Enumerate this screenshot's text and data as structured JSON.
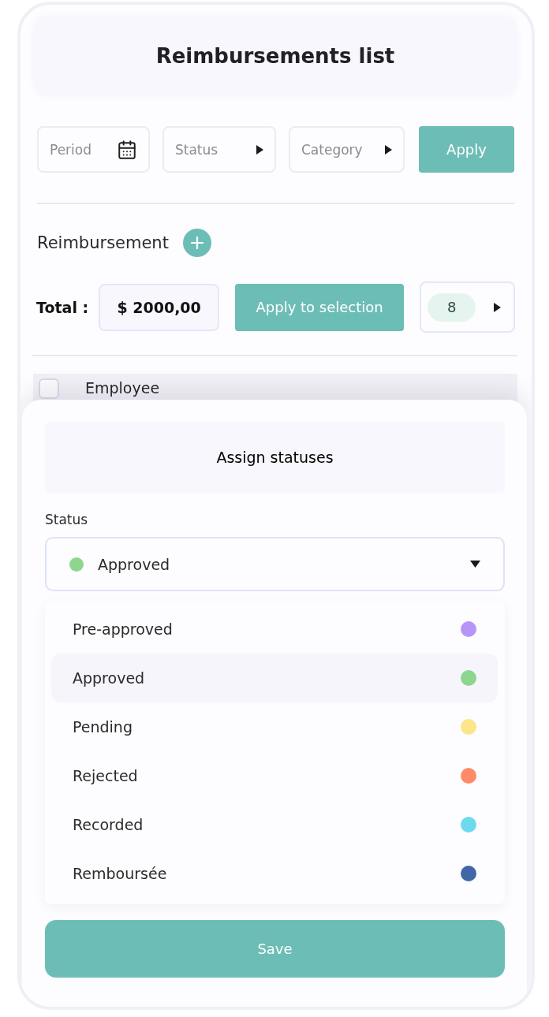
{
  "header": {
    "title": "Reimbursements list"
  },
  "filters": [
    {
      "kind": "date",
      "placeholder": "Period"
    },
    {
      "kind": "select",
      "placeholder": "Status"
    },
    {
      "kind": "select",
      "placeholder": "Category"
    }
  ],
  "apply_button": "Apply",
  "section": {
    "title": "Reimbursement"
  },
  "total": {
    "label": "Total :",
    "value": "$ 2000,00",
    "apply_button": "Apply to selection",
    "page_size": "8"
  },
  "table": {
    "select_all": {
      "checked": false
    },
    "columns": [
      {
        "label": "Employee"
      }
    ]
  },
  "sheet": {
    "title": "Assign statuses",
    "field_label": "Status",
    "select": {
      "value": "Approved",
      "color": "#8dd68e",
      "expanded": true
    },
    "options": [
      {
        "label": "Pre-approved",
        "color": "#b795f8",
        "selected": false
      },
      {
        "label": "Approved",
        "color": "#8dd68e",
        "selected": true
      },
      {
        "label": "Pending",
        "color": "#fde58a",
        "selected": false
      },
      {
        "label": "Rejected",
        "color": "#fd8b68",
        "selected": false
      },
      {
        "label": "Recorded",
        "color": "#6cd9ef",
        "selected": false
      },
      {
        "label": "Remboursée",
        "color": "#4267a6",
        "selected": false
      }
    ],
    "save_button": "Save"
  }
}
